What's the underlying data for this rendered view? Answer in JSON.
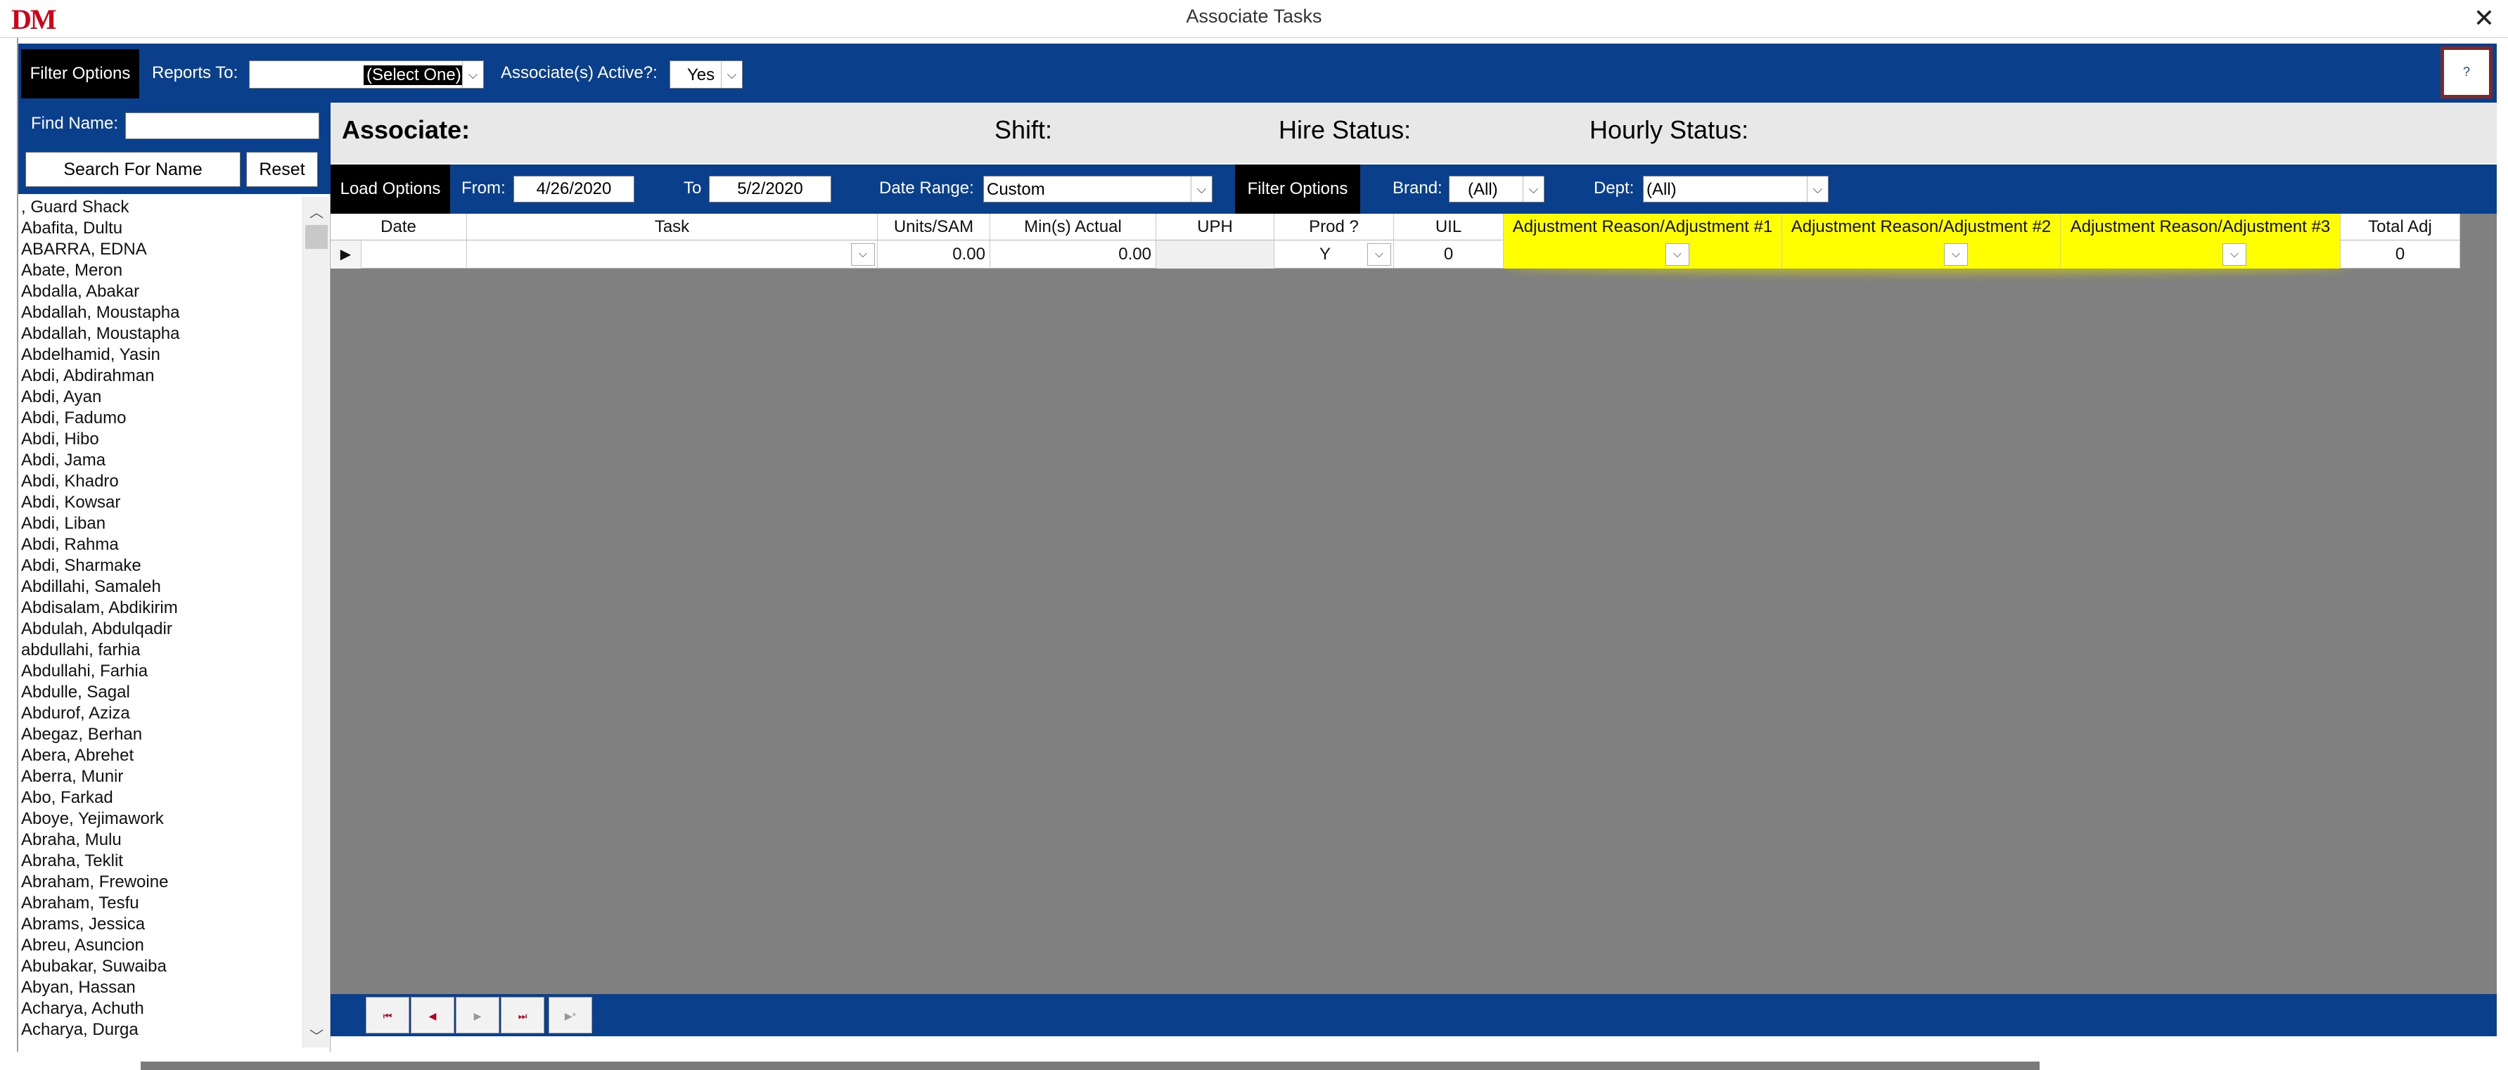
{
  "window": {
    "logo": "DM",
    "title": "Associate Tasks",
    "close": "✕"
  },
  "filter_bar": {
    "tag": "Filter Options",
    "reports_to_label": "Reports To:",
    "reports_to_value": "(Select One)",
    "active_label": "Associate(s) Active?:",
    "active_value": "Yes",
    "help_icon": "?"
  },
  "left_panel": {
    "find_label": "Find Name:",
    "find_value": "",
    "search_button": "Search For Name",
    "reset_button": "Reset",
    "names": [
      ", Guard Shack",
      "Abafita, Dultu",
      "ABARRA, EDNA",
      "Abate, Meron",
      "Abdalla, Abakar",
      "Abdallah, Moustapha",
      "Abdallah, Moustapha",
      "Abdelhamid, Yasin",
      "Abdi, Abdirahman",
      "Abdi, Ayan",
      "Abdi, Fadumo",
      "Abdi, Hibo",
      "Abdi, Jama",
      "Abdi, Khadro",
      "Abdi, Kowsar",
      "Abdi, Liban",
      "Abdi, Rahma",
      "Abdi, Sharmake",
      "Abdillahi, Samaleh",
      "Abdisalam, Abdikirim",
      "Abdulah, Abdulqadir",
      "abdullahi, farhia",
      "Abdullahi, Farhia",
      "Abdulle, Sagal",
      "Abdurof, Aziza",
      "Abegaz, Berhan",
      "Abera, Abrehet",
      "Aberra, Munir",
      "Abo, Farkad",
      "Aboye, Yejimawork",
      "Abraha, Mulu",
      "Abraha, Teklit",
      "Abraham, Frewoine",
      "Abraham, Tesfu",
      "Abrams, Jessica",
      "Abreu, Asuncion",
      "Abubakar, Suwaiba",
      "Abyan, Hassan",
      "Acharya,  Achuth",
      "Acharya, Durga"
    ]
  },
  "associate_band": {
    "associate_label": "Associate:",
    "shift_label": "Shift:",
    "hire_label": "Hire Status:",
    "hourly_label": "Hourly Status:"
  },
  "load_bar": {
    "tag": "Load Options",
    "from_label": "From:",
    "from_value": "4/26/2020",
    "to_label": "To",
    "to_value": "5/2/2020",
    "range_label": "Date Range:",
    "range_value": "Custom",
    "filter_tag": "Filter Options",
    "brand_label": "Brand:",
    "brand_value": "(All)",
    "dept_label": "Dept:",
    "dept_value": "(All)"
  },
  "grid": {
    "columns": [
      "Date",
      "Task",
      "Units/SAM",
      "Min(s) Actual",
      "UPH",
      "Prod ?",
      "UIL",
      "Adjustment Reason/Adjustment #1",
      "Adjustment Reason/Adjustment #2",
      "Adjustment Reason/Adjustment #3",
      "Total Adj"
    ],
    "row": {
      "date": "",
      "task": "",
      "units": "0.00",
      "mins": "0.00",
      "uph": "",
      "prod": "Y",
      "uil": "0",
      "total_adj": "0"
    },
    "highlight_color": "#ffff00"
  },
  "colors": {
    "header_blue": "#0a3f8c",
    "grid_gray": "#808080",
    "tag_black": "#000000"
  }
}
